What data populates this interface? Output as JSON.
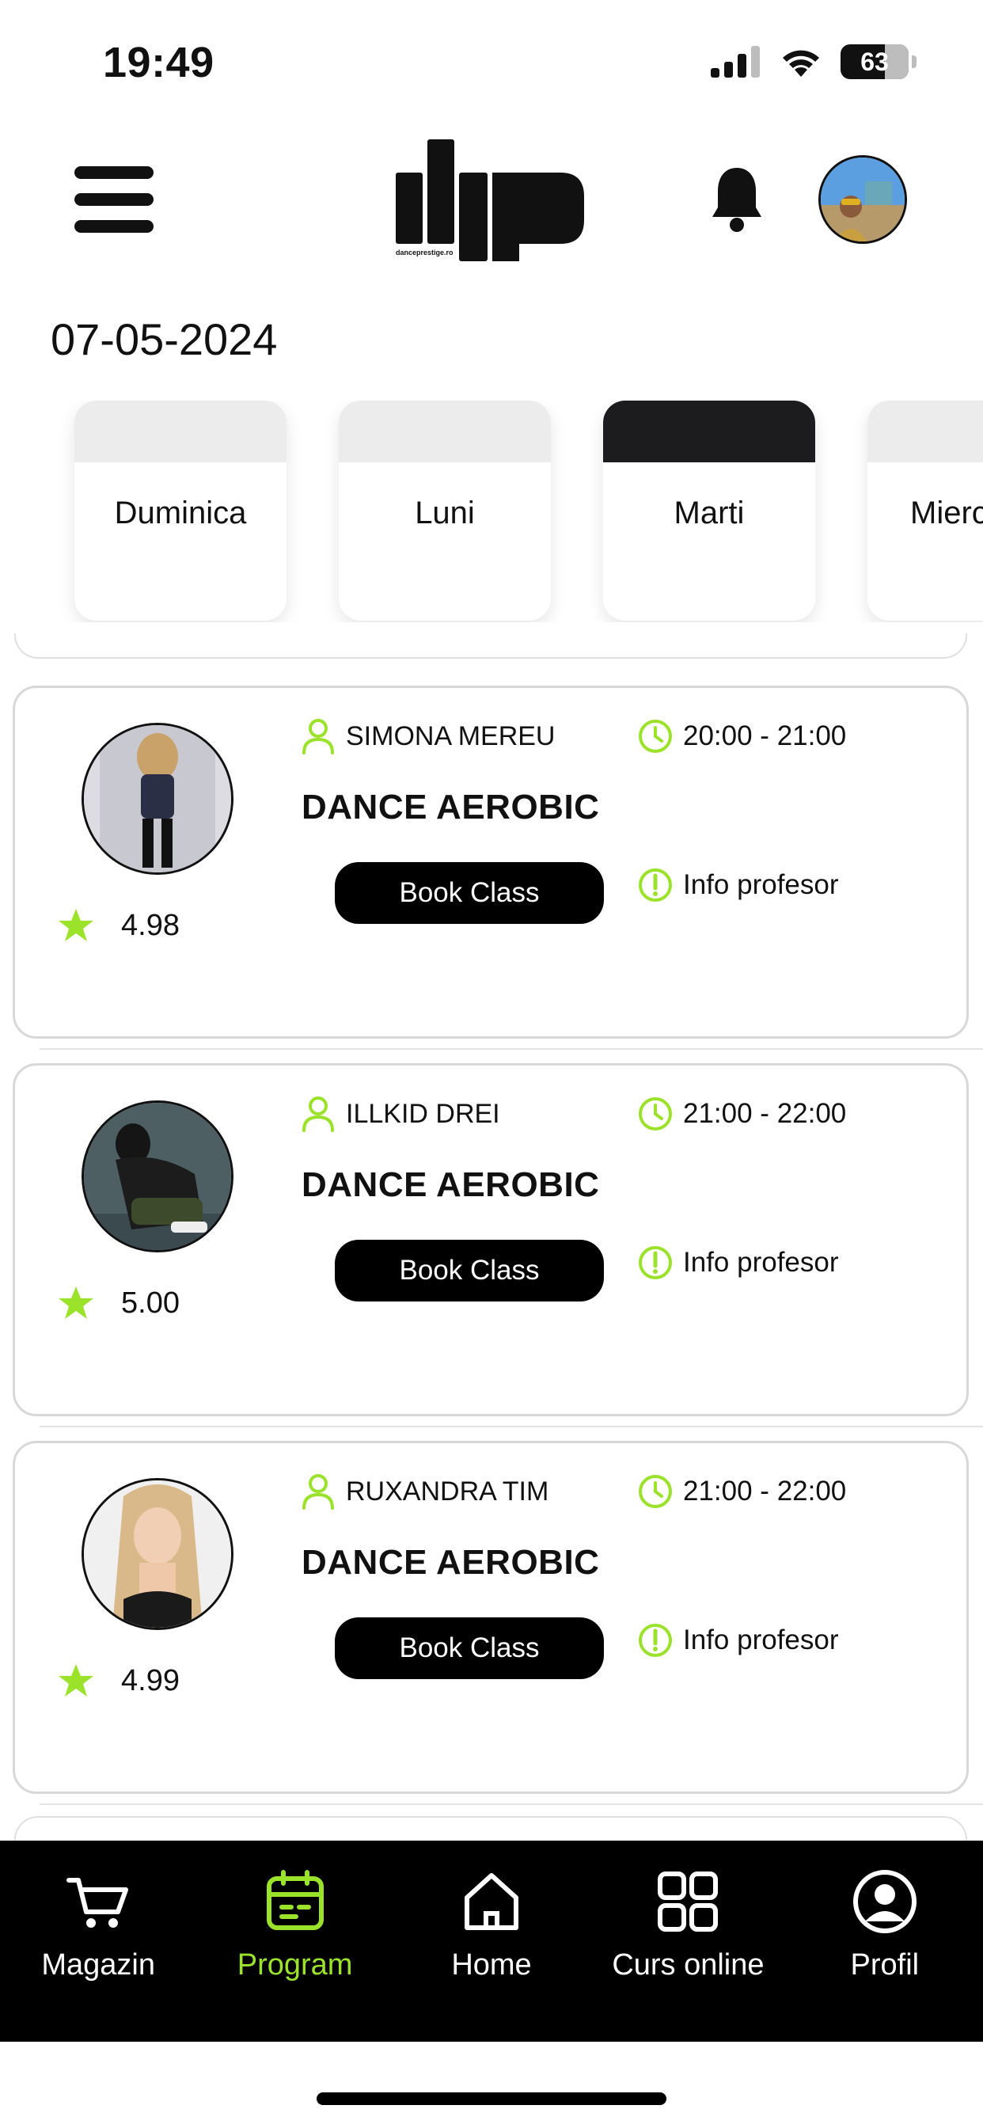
{
  "status": {
    "time": "19:49",
    "battery": "63"
  },
  "header": {
    "logo_text": "danceprestige.ro"
  },
  "date": "07-05-2024",
  "days": [
    {
      "label": "Duminica",
      "active": false
    },
    {
      "label": "Luni",
      "active": false
    },
    {
      "label": "Marti",
      "active": true
    },
    {
      "label": "Mierc",
      "active": false
    }
  ],
  "classes": [
    {
      "teacher": "SIMONA MEREU",
      "time": "20:00 - 21:00",
      "name": "DANCE AEROBIC",
      "book_label": "Book Class",
      "info_label": "Info profesor",
      "rating": "4.98"
    },
    {
      "teacher": "ILLKID DREI",
      "time": "21:00 - 22:00",
      "name": "DANCE AEROBIC",
      "book_label": "Book Class",
      "info_label": "Info profesor",
      "rating": "5.00"
    },
    {
      "teacher": "RUXANDRA TIM",
      "time": "21:00 - 22:00",
      "name": "DANCE AEROBIC",
      "book_label": "Book Class",
      "info_label": "Info profesor",
      "rating": "4.99"
    }
  ],
  "tabbar": [
    {
      "label": "Magazin",
      "icon": "cart-icon",
      "active": false
    },
    {
      "label": "Program",
      "icon": "calendar-icon",
      "active": true
    },
    {
      "label": "Home",
      "icon": "home-icon",
      "active": false
    },
    {
      "label": "Curs online",
      "icon": "grid-icon",
      "active": false
    },
    {
      "label": "Profil",
      "icon": "profile-icon",
      "active": false
    }
  ],
  "colors": {
    "accent": "#9be22b",
    "background": "#ffffff",
    "tabbar": "#000000"
  }
}
